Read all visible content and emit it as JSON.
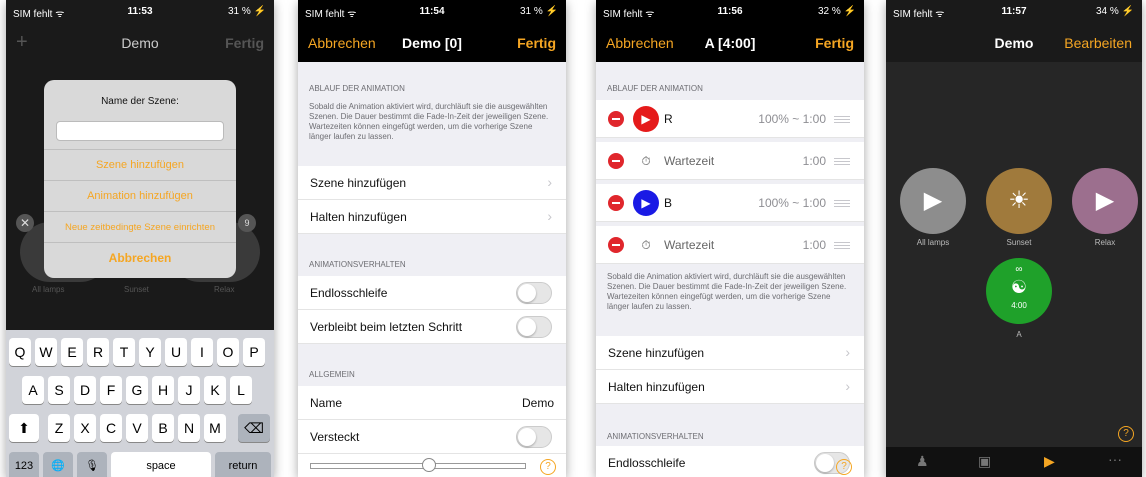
{
  "phone1": {
    "status": {
      "carrier": "SIM fehlt ᯤ",
      "time": "11:53",
      "battery": "31 % ⚡"
    },
    "nav": {
      "left": "+",
      "title": "Demo",
      "right": "Fertig"
    },
    "dialog": {
      "title": "Name der Szene:",
      "input_value": "",
      "options": [
        "Szene hinzufügen",
        "Animation hinzufügen",
        "Neue zeitbedingte Szene einrichten"
      ],
      "cancel": "Abbrechen"
    },
    "background_labels": [
      "All lamps",
      "Sunset",
      "Relax"
    ],
    "badges": {
      "close": "✕",
      "count": "9"
    },
    "keyboard": {
      "row1": [
        "Q",
        "W",
        "E",
        "R",
        "T",
        "Y",
        "U",
        "I",
        "O",
        "P"
      ],
      "row2": [
        "A",
        "S",
        "D",
        "F",
        "G",
        "H",
        "J",
        "K",
        "L"
      ],
      "row3": [
        "Z",
        "X",
        "C",
        "V",
        "B",
        "N",
        "M"
      ],
      "shift": "⬆",
      "backspace": "⌫",
      "numbers": "123",
      "globe": "🌐",
      "mic": "🎙",
      "space": "space",
      "return": "return"
    }
  },
  "phone2": {
    "status": {
      "carrier": "SIM fehlt ᯤ",
      "time": "11:54",
      "battery": "31 % ⚡"
    },
    "nav": {
      "left": "Abbrechen",
      "title": "Demo [0]",
      "right": "Fertig"
    },
    "section_ablauf": "ABLAUF DER ANIMATION",
    "note": "Sobald die Animation aktiviert wird, durchläuft sie die ausgewählten Szenen. Die Dauer bestimmt die Fade-In-Zeit der jeweiligen Szene. Wartezeiten können eingefügt werden, um die vorherige Szene länger laufen zu lassen.",
    "add_scene": "Szene hinzufügen",
    "add_hold": "Halten hinzufügen",
    "section_verhalten": "ANIMATIONSVERHALTEN",
    "loop": "Endlosschleife",
    "stay_last": "Verbleibt beim letzten Schritt",
    "section_allgemein": "ALLGEMEIN",
    "name_label": "Name",
    "name_value": "Demo",
    "hidden": "Versteckt",
    "help": "?"
  },
  "phone3": {
    "status": {
      "carrier": "SIM fehlt ᯤ",
      "time": "11:56",
      "battery": "32 % ⚡"
    },
    "nav": {
      "left": "Abbrechen",
      "title": "A [4:00]",
      "right": "Fertig"
    },
    "section_ablauf": "ABLAUF DER ANIMATION",
    "steps": [
      {
        "label": "R",
        "value": "100% ~ 1:00",
        "color": "#e51a1a"
      },
      {
        "label": "Wartezeit",
        "value": "1:00"
      },
      {
        "label": "B",
        "value": "100% ~ 1:00",
        "color": "#1a1ae5"
      },
      {
        "label": "Wartezeit",
        "value": "1:00"
      }
    ],
    "note": "Sobald die Animation aktiviert wird, durchläuft sie die ausgewählten Szenen. Die Dauer bestimmt die Fade-In-Zeit der jeweiligen Szene. Wartezeiten können eingefügt werden, um die vorherige Szene länger laufen zu lassen.",
    "add_scene": "Szene hinzufügen",
    "add_hold": "Halten hinzufügen",
    "section_verhalten": "ANIMATIONSVERHALTEN",
    "loop": "Endlosschleife",
    "help": "?"
  },
  "phone4": {
    "status": {
      "carrier": "SIM fehlt ᯤ",
      "time": "11:57",
      "battery": "34 % ⚡"
    },
    "nav": {
      "title": "Demo",
      "right": "Bearbeiten"
    },
    "scenes": [
      {
        "label": "All lamps",
        "color": "#8d8d8d"
      },
      {
        "label": "Sunset",
        "color": "#a07a3c"
      },
      {
        "label": "Relax",
        "color": "#9c6f8e"
      }
    ],
    "animation": {
      "label": "A",
      "duration": "4:00",
      "loop_symbol": "∞",
      "color": "#1fa12a"
    },
    "help": "?"
  }
}
